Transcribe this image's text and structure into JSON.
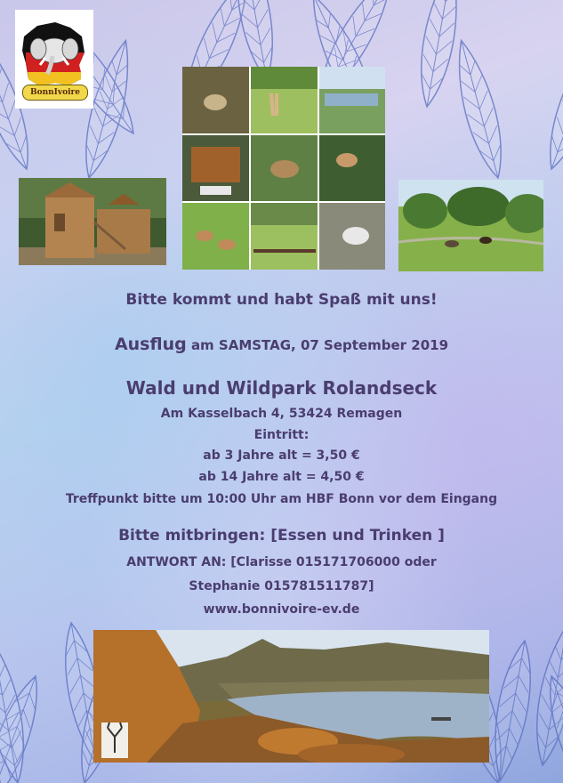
{
  "logo": {
    "text": "BonnIvoire"
  },
  "lines": {
    "invite": "Bitte kommt und habt Spaß mit uns!",
    "trip_word": "Ausflug",
    "trip_date": "am SAMSTAG, 07 September 2019",
    "venue": "Wald und Wildpark Rolandseck",
    "address": "Am Kasselbach 4, 53424 Remagen",
    "admission": "Eintritt:",
    "price_3": "ab 3 Jahre alt = 3,50 €",
    "price_14": "ab 14 Jahre alt = 4,50 €",
    "meeting": "Treffpunkt bitte um 10:00 Uhr am HBF Bonn vor dem Eingang",
    "bring": "Bitte mitbringen: [Essen und Trinken ]",
    "reply_1": "ANTWORT AN: [Clarisse 015171706000 oder",
    "reply_2": "Stephanie 015781511787]",
    "website": "www.bonnivoire-ev.de"
  },
  "colors": {
    "text": "#4a3d6f",
    "logo_badge": "#f1d84a"
  }
}
